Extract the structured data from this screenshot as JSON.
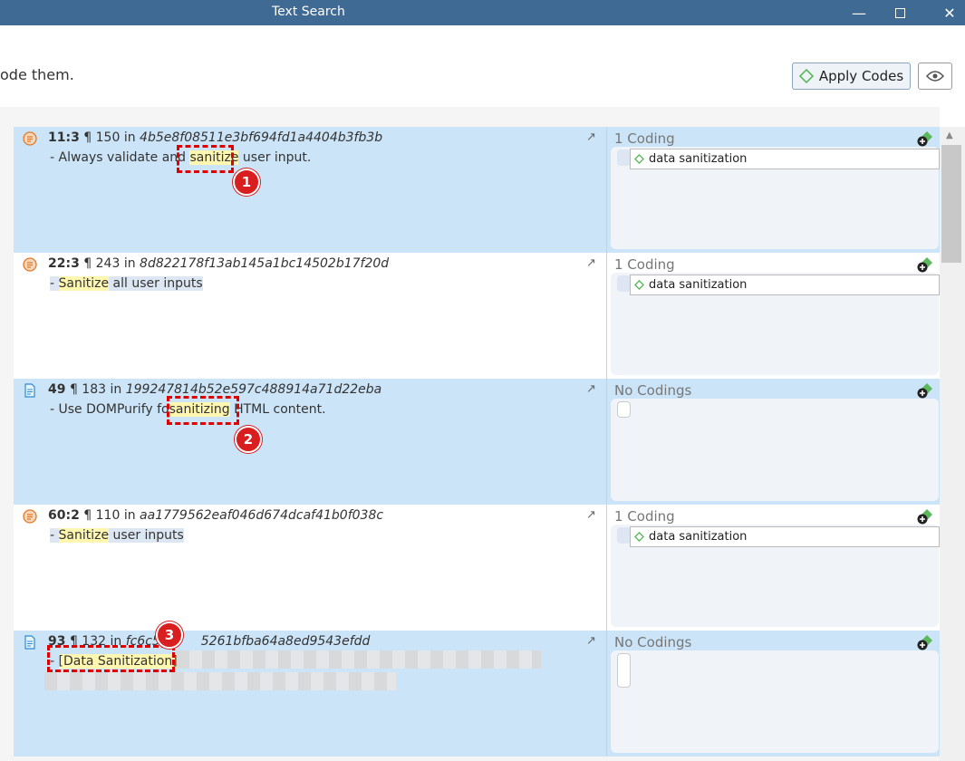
{
  "window": {
    "title": "Text Search",
    "min": "—",
    "max": "☐",
    "close": "✕"
  },
  "header": {
    "instruction": "ode them.",
    "apply_label": "Apply Codes"
  },
  "rows": [
    {
      "loc": "11:3",
      "para": "¶ 150",
      "in": "in",
      "hash": "4b5e8f08511e3bf694fd1a4404b3fb3b",
      "pre": "- Always validate and ",
      "hit": "sanitize",
      "post": " user input.",
      "codings": "1 Coding",
      "code": "data sanitization",
      "badge": "1"
    },
    {
      "loc": "22:3",
      "para": "¶ 243",
      "in": "in",
      "hash": "8d822178f13ab145a1bc14502b17f20d",
      "pre": "- ",
      "hit": "Sanitize",
      "post": " all user inputs",
      "codings": "1 Coding",
      "code": "data sanitization"
    },
    {
      "loc": "49",
      "para": "¶ 183",
      "in": "in",
      "hash": "199247814b52e597c488914a71d22eba",
      "pre": "- Use DOMPurify fo",
      "hit": "sanitizing",
      "post": " HTML content.",
      "codings": "No Codings",
      "badge": "2"
    },
    {
      "loc": "60:2",
      "para": "¶ 110",
      "in": "in",
      "hash": "aa1779562eaf046d674dcaf41b0f038c",
      "pre": "- ",
      "hit": "Sanitize",
      "post": " user inputs",
      "codings": "1 Coding",
      "code": "data sanitization"
    },
    {
      "loc": "93",
      "para": "¶ 132",
      "in": "in",
      "hash": "fc6c52",
      "hash2": "5261bfba64a8ed9543efdd",
      "pre": "- ",
      "hit": "[Data Sanitization]",
      "post": "",
      "codings": "No Codings",
      "badge": "3"
    }
  ],
  "colors": {
    "titlebar": "#3f6a94",
    "selected": "#cce4f7",
    "highlight": "#fff6b0",
    "annotation": "#e00000"
  }
}
